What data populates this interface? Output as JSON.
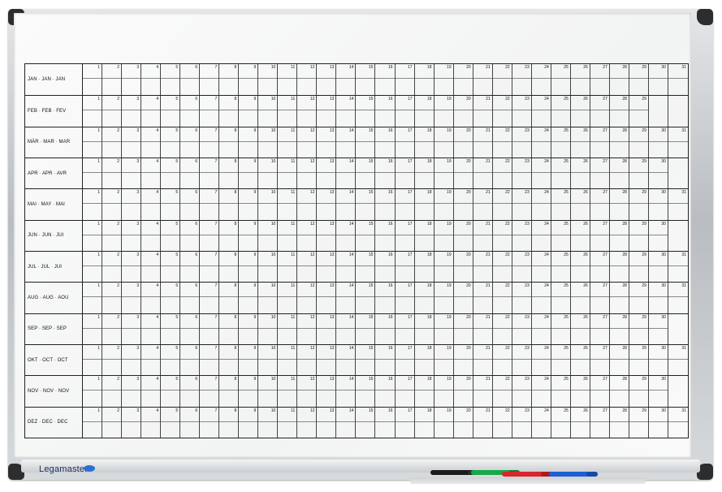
{
  "brand": "Legamaster",
  "months": [
    {
      "label": "JAN · JAN · JAN",
      "days": 31
    },
    {
      "label": "FEB · FEB · FEV",
      "days": 29
    },
    {
      "label": "MÄR · MAR · MAR",
      "days": 31
    },
    {
      "label": "APR · APR · AVR",
      "days": 30
    },
    {
      "label": "MAI · MAY · MAI",
      "days": 31
    },
    {
      "label": "JUN · JUN · JUI",
      "days": 30
    },
    {
      "label": "JUL · JUL · JUI",
      "days": 31
    },
    {
      "label": "AUG · AUG · AOU",
      "days": 31
    },
    {
      "label": "SEP · SEP · SEP",
      "days": 30
    },
    {
      "label": "OKT · OCT · OCT",
      "days": 31
    },
    {
      "label": "NOV · NOV · NOV",
      "days": 30
    },
    {
      "label": "DEZ · DEC · DEC",
      "days": 31
    }
  ],
  "markers": [
    {
      "name": "black-marker",
      "color": "#1a1a1a",
      "cap": "#2a2a2a"
    },
    {
      "name": "green-marker",
      "color": "#17a84a",
      "cap": "#0f7d35"
    },
    {
      "name": "red-marker",
      "color": "#d8262b",
      "cap": "#a91b1f"
    },
    {
      "name": "blue-marker",
      "color": "#1f5fd4",
      "cap": "#174aa8"
    }
  ]
}
